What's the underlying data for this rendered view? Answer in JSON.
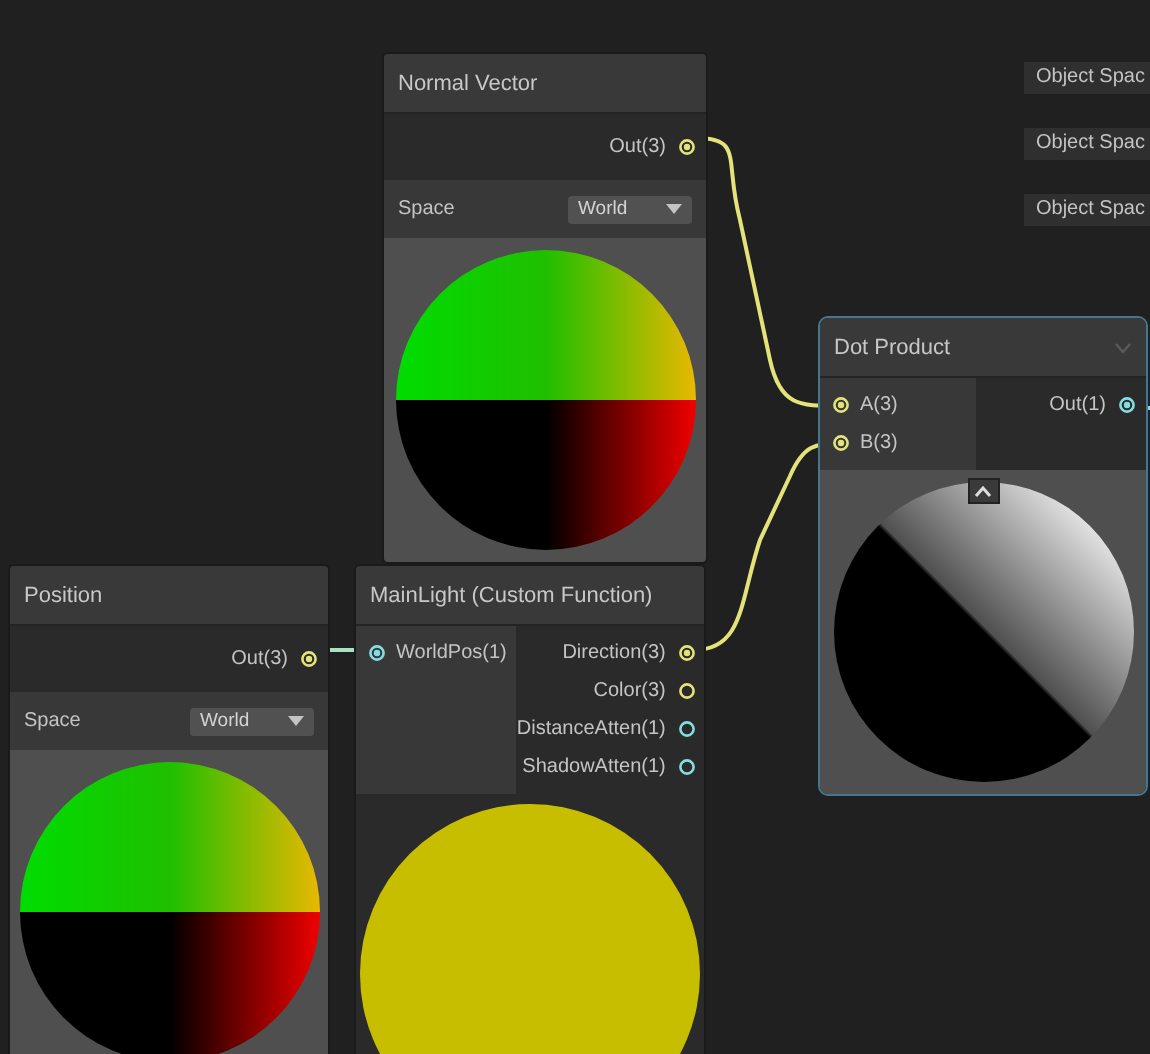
{
  "labels": [
    {
      "text": "Object Spac"
    },
    {
      "text": "Object Spac"
    },
    {
      "text": "Object Spac"
    }
  ],
  "nodes": [
    {
      "title": "Normal Vector",
      "selected": false,
      "outputs": [
        {
          "label": "Out(3)",
          "kind": "vector3",
          "connected": true
        }
      ],
      "space": {
        "label": "Space",
        "value": "World"
      },
      "preview": {
        "kind": "normal"
      }
    },
    {
      "title": "Dot Product",
      "selected": true,
      "expanded": true,
      "inputs": [
        {
          "label": "A(3)",
          "kind": "vector3",
          "connected": true
        },
        {
          "label": "B(3)",
          "kind": "vector3",
          "connected": true
        }
      ],
      "outputs": [
        {
          "label": "Out(1)",
          "kind": "float",
          "connected": true
        }
      ],
      "preview": {
        "kind": "dot"
      }
    },
    {
      "title": "Position",
      "selected": false,
      "outputs": [
        {
          "label": "Out(3)",
          "kind": "vector3",
          "connected": true
        }
      ],
      "space": {
        "label": "Space",
        "value": "World"
      },
      "preview": {
        "kind": "normal"
      }
    },
    {
      "title": "MainLight (Custom Function)",
      "selected": false,
      "inputs": [
        {
          "label": "WorldPos(1)",
          "kind": "float",
          "connected": true
        }
      ],
      "outputs": [
        {
          "label": "Direction(3)",
          "kind": "vector3",
          "connected": true
        },
        {
          "label": "Color(3)",
          "kind": "vector3",
          "connected": false
        },
        {
          "label": "DistanceAtten(1)",
          "kind": "float",
          "connected": false
        },
        {
          "label": "ShadowAtten(1)",
          "kind": "float",
          "connected": false
        }
      ],
      "preview": {
        "kind": "flat"
      }
    }
  ]
}
